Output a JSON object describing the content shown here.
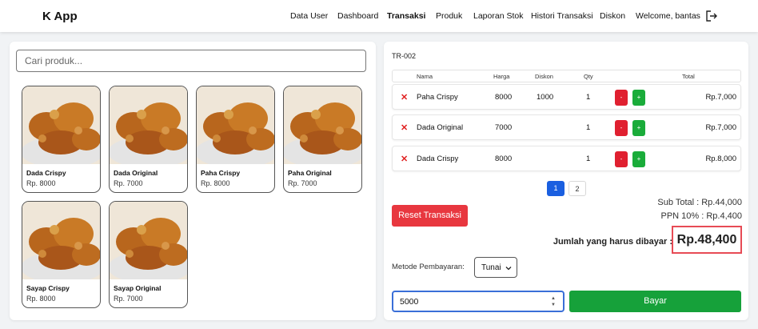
{
  "nav": {
    "brand": "K App",
    "items": [
      "Data User",
      "Dashboard",
      "Transaksi",
      "Produk",
      "Laporan Stok",
      "Histori Transaksi",
      "Diskon"
    ],
    "active": "Transaksi",
    "welcome": "Welcome, bantas",
    "logout_icon": "logout-icon"
  },
  "search": {
    "placeholder": "Cari produk..."
  },
  "products": [
    {
      "name": "Dada Crispy",
      "price": "Rp. 8000"
    },
    {
      "name": "Dada Original",
      "price": "Rp. 7000"
    },
    {
      "name": "Paha Crispy",
      "price": "Rp. 8000"
    },
    {
      "name": "Paha Original",
      "price": "Rp. 7000"
    },
    {
      "name": "Sayap Crispy",
      "price": "Rp. 8000"
    },
    {
      "name": "Sayap Original",
      "price": "Rp. 7000"
    }
  ],
  "transaction": {
    "id": "TR-002",
    "columns": {
      "nama": "Nama",
      "harga": "Harga",
      "diskon": "Diskon",
      "qty": "Qty",
      "total": "Total"
    },
    "rows": [
      {
        "nama": "Paha Crispy",
        "harga": "8000",
        "diskon": "1000",
        "qty": "1",
        "total": "Rp.7,000"
      },
      {
        "nama": "Dada Original",
        "harga": "7000",
        "diskon": "",
        "qty": "1",
        "total": "Rp.7,000"
      },
      {
        "nama": "Dada Crispy",
        "harga": "8000",
        "diskon": "",
        "qty": "1",
        "total": "Rp.8,000"
      }
    ],
    "remove_symbol": "✕",
    "minus_label": "-",
    "plus_label": "+",
    "pages": [
      "1",
      "2"
    ],
    "reset_label": "Reset Transaksi",
    "subtotal": "Sub Total : Rp.44,000",
    "ppn": "PPN 10% : Rp.4,400",
    "due_label": "Jumlah yang harus dibayar :",
    "due_value": "Rp.48,400",
    "payment_label": "Metode Pembayaran:",
    "payment_method": "Tunai",
    "amount_value": "5000",
    "pay_label": "Bayar"
  },
  "colors": {
    "primary": "#1a5fe0",
    "danger": "#e8373f",
    "success": "#16a13a"
  }
}
